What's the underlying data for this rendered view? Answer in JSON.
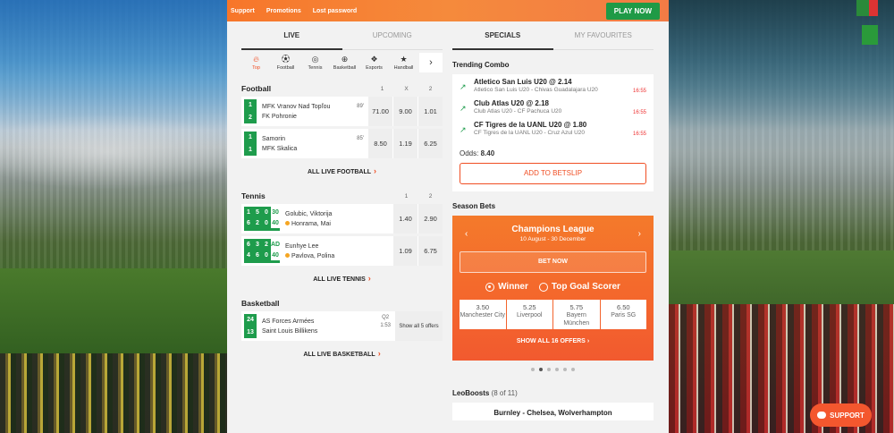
{
  "topbar": {
    "links": [
      "Support",
      "Promotions",
      "Lost password"
    ],
    "play_now": "PLAY NOW"
  },
  "left": {
    "tabs": [
      "LIVE",
      "UPCOMING"
    ],
    "sports": [
      {
        "label": "Top",
        "icon": "flame-icon"
      },
      {
        "label": "Football",
        "icon": "football-icon"
      },
      {
        "label": "Tennis",
        "icon": "tennis-ball-icon"
      },
      {
        "label": "Basketball",
        "icon": "basketball-icon"
      },
      {
        "label": "Esports",
        "icon": "gamepad-icon"
      },
      {
        "label": "Handball",
        "icon": "handball-icon"
      }
    ],
    "football": {
      "title": "Football",
      "cols": [
        "1",
        "X",
        "2"
      ],
      "matches": [
        {
          "s1": "1",
          "s2": "2",
          "home": "MFK Vranov Nad Topľou",
          "away": "FK Pohronie",
          "minute": "89'",
          "o1": "71.00",
          "ox": "9.00",
          "o2": "1.01"
        },
        {
          "s1": "1",
          "s2": "1",
          "home": "Samorin",
          "away": "MFK Skalica",
          "minute": "85'",
          "o1": "8.50",
          "ox": "1.19",
          "o2": "6.25"
        }
      ],
      "all_link": "ALL LIVE FOOTBALL"
    },
    "tennis": {
      "title": "Tennis",
      "cols": [
        "1",
        "2"
      ],
      "matches": [
        {
          "p1": [
            "1",
            "5",
            "0",
            "30"
          ],
          "p2": [
            "6",
            "2",
            "0",
            "40"
          ],
          "home": "Golubic, Viktorija",
          "away": "Honrama, Mai",
          "o1": "1.40",
          "o2": "2.90"
        },
        {
          "p1": [
            "6",
            "3",
            "2",
            "AD"
          ],
          "p2": [
            "4",
            "6",
            "0",
            "40"
          ],
          "home": "Eunhye Lee",
          "away": "Pavlova, Polina",
          "o1": "1.09",
          "o2": "6.75"
        }
      ],
      "all_link": "ALL LIVE TENNIS"
    },
    "basketball": {
      "title": "Basketball",
      "match": {
        "s1": "24",
        "s2": "13",
        "home": "AS Forces Armées",
        "away": "Saint Louis Billikens",
        "quarter": "Q2",
        "clock": "1:53",
        "offers": "Show all 5 offers"
      },
      "all_link": "ALL LIVE BASKETBALL"
    }
  },
  "right": {
    "tabs": [
      "SPECIALS",
      "MY FAVOURITES"
    ],
    "trending_title": "Trending Combo",
    "combo": [
      {
        "sel": "Atletico San Luis U20 @ 2.14",
        "match": "Atletico San Luis U20 - Chivas Guadalajara U20",
        "time": "16:55"
      },
      {
        "sel": "Club Atlas U20 @ 2.18",
        "match": "Club Atlas U20 - CF Pachuca U20",
        "time": "16:55"
      },
      {
        "sel": "CF Tigres de la UANL U20 @ 1.80",
        "match": "CF Tigres de la UANL U20 - Cruz Azul U20",
        "time": "16:55"
      }
    ],
    "odds_label": "Odds:",
    "odds_value": "8.40",
    "add_betslip": "ADD TO BETSLIP",
    "season_title": "Season Bets",
    "season": {
      "league": "Champions League",
      "dates": "10 August - 30 December",
      "bet_now": "BET NOW",
      "radio_winner": "Winner",
      "radio_scorer": "Top Goal Scorer",
      "outcomes": [
        {
          "odd": "3.50",
          "team": "Manchester City"
        },
        {
          "odd": "5.25",
          "team": "Liverpool"
        },
        {
          "odd": "5.75",
          "team": "Bayern München"
        },
        {
          "odd": "6.50",
          "team": "Paris SG"
        }
      ],
      "show_all": "SHOW ALL 16 OFFERS"
    },
    "boosts_title": "LeoBoosts",
    "boosts_count": "(8 of 11)",
    "boost_match": "Burnley - Chelsea, Wolverhampton"
  },
  "support_button": "SUPPORT",
  "colors": {
    "brand_orange": "#f47a2b",
    "live_green": "#1e9c4c",
    "accent_red": "#f04e23"
  }
}
